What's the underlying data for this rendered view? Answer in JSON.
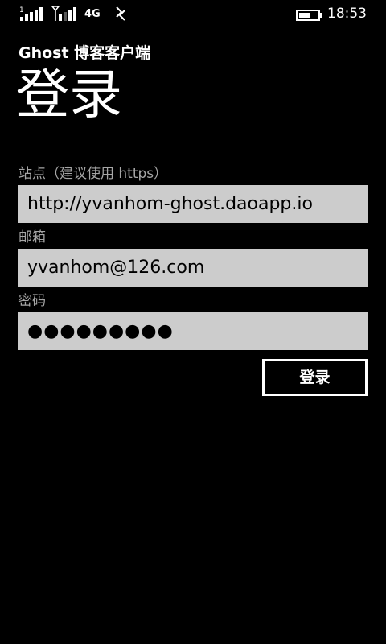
{
  "status_bar": {
    "network_type": "4G",
    "time": "18:53",
    "icons": [
      "signal-strength-sim1-icon",
      "signal-strength-sim2-icon",
      "data-transfer-icon",
      "battery-icon"
    ]
  },
  "app_title": "Ghost 博客客户端",
  "page_title": "登录",
  "form": {
    "site_label": "站点（建议使用 https）",
    "site_value": "http://yvanhom-ghost.daoapp.io",
    "email_label": "邮箱",
    "email_value": "yvanhom@126.com",
    "password_label": "密码",
    "password_value": "●●●●●●●●●",
    "login_button_label": "登录"
  },
  "colors": {
    "background": "#000000",
    "field_background": "#cccccc",
    "label_text": "#a6a6a6",
    "foreground": "#ffffff"
  }
}
